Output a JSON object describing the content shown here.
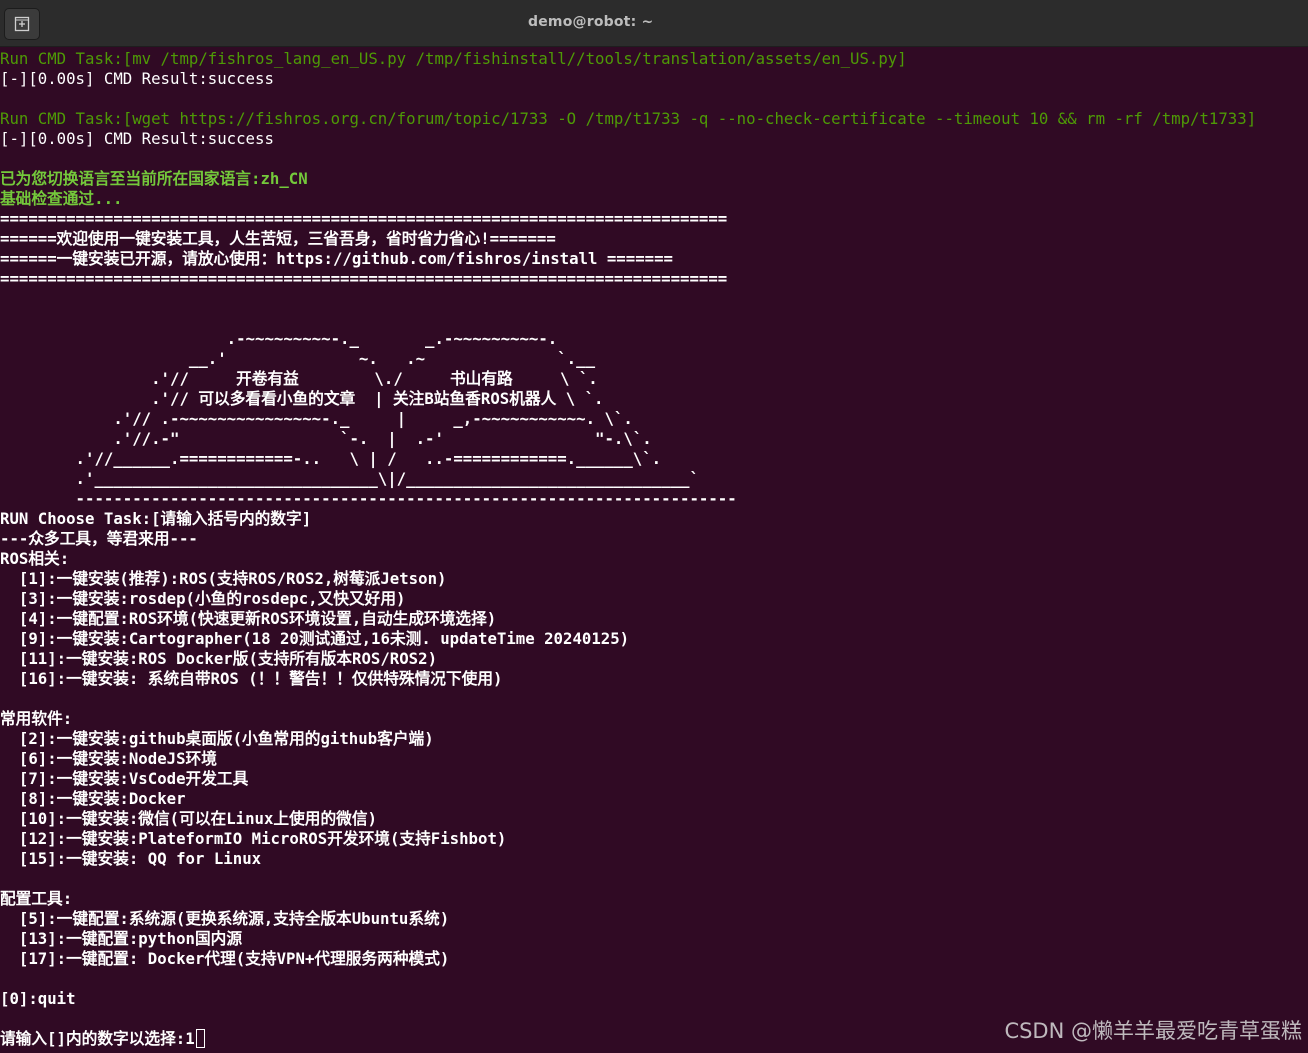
{
  "window": {
    "title": "demo@robot: ~",
    "new_tab_icon": "new-tab-icon"
  },
  "colors": {
    "background": "#300a24",
    "text": "#ffffff",
    "green": "#4e9a06",
    "titlebar": "#2c2c2c"
  },
  "terminal": {
    "lines": [
      {
        "text": "Run CMD Task:[mv /tmp/fishros_lang_en_US.py /tmp/fishinstall//tools/translation/assets/en_US.py]",
        "style": "green"
      },
      {
        "text": "[-][0.00s] CMD Result:success",
        "style": "normal"
      },
      {
        "text": "",
        "style": "normal"
      },
      {
        "text": "Run CMD Task:[wget https://fishros.org.cn/forum/topic/1733 -O /tmp/t1733 -q --no-check-certificate --timeout 10 && rm -rf /tmp/t1733]",
        "style": "green"
      },
      {
        "text": "[-][0.00s] CMD Result:success",
        "style": "normal"
      },
      {
        "text": "",
        "style": "normal"
      },
      {
        "text": "已为您切换语言至当前所在国家语言:zh_CN",
        "style": "green-bold"
      },
      {
        "text": "基础检查通过...",
        "style": "green-bold"
      },
      {
        "text": "=============================================================================",
        "style": "bold"
      },
      {
        "text": "======欢迎使用一键安装工具，人生苦短，三省吾身，省时省力省心!=======",
        "style": "bold"
      },
      {
        "text": "======一键安装已开源，请放心使用：https://github.com/fishros/install =======",
        "style": "bold"
      },
      {
        "text": "=============================================================================",
        "style": "bold"
      },
      {
        "text": "",
        "style": "normal"
      },
      {
        "text": "",
        "style": "normal"
      },
      {
        "text": "                        .-~~~~~~~~~-._       _.-~~~~~~~~~-.",
        "style": "bold"
      },
      {
        "text": "                    __.'              ~.   .~              `.__",
        "style": "bold"
      },
      {
        "text": "                .'//     开卷有益        \\./     书山有路     \\ `.",
        "style": "bold"
      },
      {
        "text": "                .'// 可以多看看小鱼的文章  | 关注B站鱼香ROS机器人 \\ `.",
        "style": "bold"
      },
      {
        "text": "            .'// .-~~~~~~~~~~~~~~~-._     |     _,-~~~~~~~~~~~. \\`.",
        "style": "bold"
      },
      {
        "text": "            .'//.-\"                 `-.  |  .-'                \"-.\\`.",
        "style": "bold"
      },
      {
        "text": "        .'//______.============-..   \\ | /   ..-============.______\\`.",
        "style": "bold"
      },
      {
        "text": "        .'______________________________\\|/______________________________`",
        "style": "bold"
      },
      {
        "text": "        ----------------------------------------------------------------------",
        "style": "bold"
      },
      {
        "text": "RUN Choose Task:[请输入括号内的数字]",
        "style": "bold"
      },
      {
        "text": "---众多工具，等君来用---",
        "style": "bold"
      },
      {
        "text": "ROS相关:",
        "style": "bold"
      },
      {
        "text": "  [1]:一键安装(推荐):ROS(支持ROS/ROS2,树莓派Jetson)",
        "style": "bold"
      },
      {
        "text": "  [3]:一键安装:rosdep(小鱼的rosdepc,又快又好用)",
        "style": "bold"
      },
      {
        "text": "  [4]:一键配置:ROS环境(快速更新ROS环境设置,自动生成环境选择)",
        "style": "bold"
      },
      {
        "text": "  [9]:一键安装:Cartographer(18 20测试通过,16未测. updateTime 20240125)",
        "style": "bold"
      },
      {
        "text": "  [11]:一键安装:ROS Docker版(支持所有版本ROS/ROS2)",
        "style": "bold"
      },
      {
        "text": "  [16]:一键安装: 系统自带ROS (！！警告！！仅供特殊情况下使用)",
        "style": "bold"
      },
      {
        "text": "",
        "style": "normal"
      },
      {
        "text": "常用软件:",
        "style": "bold"
      },
      {
        "text": "  [2]:一键安装:github桌面版(小鱼常用的github客户端)",
        "style": "bold"
      },
      {
        "text": "  [6]:一键安装:NodeJS环境",
        "style": "bold"
      },
      {
        "text": "  [7]:一键安装:VsCode开发工具",
        "style": "bold"
      },
      {
        "text": "  [8]:一键安装:Docker",
        "style": "bold"
      },
      {
        "text": "  [10]:一键安装:微信(可以在Linux上使用的微信)",
        "style": "bold"
      },
      {
        "text": "  [12]:一键安装:PlateformIO MicroROS开发环境(支持Fishbot)",
        "style": "bold"
      },
      {
        "text": "  [15]:一键安装: QQ for Linux",
        "style": "bold"
      },
      {
        "text": "",
        "style": "normal"
      },
      {
        "text": "配置工具:",
        "style": "bold"
      },
      {
        "text": "  [5]:一键配置:系统源(更换系统源,支持全版本Ubuntu系统)",
        "style": "bold"
      },
      {
        "text": "  [13]:一键配置:python国内源",
        "style": "bold"
      },
      {
        "text": "  [17]:一键配置: Docker代理(支持VPN+代理服务两种模式)",
        "style": "bold"
      },
      {
        "text": "",
        "style": "normal"
      },
      {
        "text": "[0]:quit",
        "style": "bold"
      },
      {
        "text": "",
        "style": "normal"
      }
    ],
    "prompt": {
      "text": "请输入[]内的数字以选择:",
      "input_value": "1"
    }
  },
  "watermark": "CSDN @懒羊羊最爱吃青草蛋糕"
}
